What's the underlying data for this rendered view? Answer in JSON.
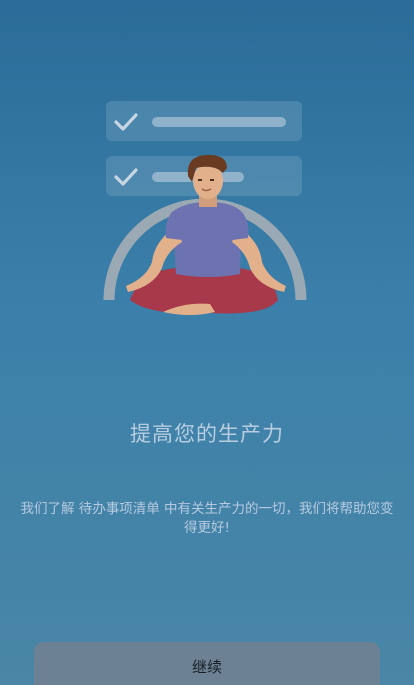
{
  "onboarding": {
    "title": "提高您的生产力",
    "description": "我们了解 待办事项清单 中有关生产力的一切，我们将帮助您变得更好!",
    "continue_label": "继续"
  },
  "colors": {
    "background_top": "#2b6c99",
    "background_bottom": "#4a86a6",
    "button_bg": "#6c8294",
    "shirt": "#6d72b0",
    "pants": "#a8394a"
  },
  "icons": {
    "checklist_item_1": "checkmark-icon",
    "checklist_item_2": "checkmark-icon"
  }
}
